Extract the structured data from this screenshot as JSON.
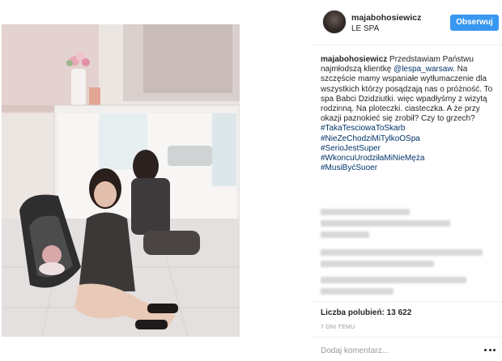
{
  "post": {
    "username": "majabohosiewicz",
    "location": "LE SPA",
    "follow_label": "Obserwuj",
    "caption": {
      "username": "majabohosiewicz",
      "text_before_mention": "Przedstawiam Państwu najmłodszą klientkę",
      "mention": "@lespa_warsaw",
      "text_after_mention": ". Na szczęście mamy wspaniałe wytłumaczenie dla wszystkich którzy posądzają nas o próżność. To spa Babci Dzidziutki. więc wpadłyśmy z wizytą rodzinną. Na ploteczki. ciasteczka. A że przy okazji paznokieć się zrobił? Czy to grzech?",
      "hashtags": [
        "#TakaTesciowaToSkarb",
        "#NieZeChodziMiTylkoOSpa",
        "#SerioJestSuper",
        "#WkoncuUrodziłaMiNieMęża",
        "#MusiByćSuoer"
      ]
    },
    "likes_label": "Liczba polubień: 13 622",
    "timestamp": "7 DNI TEMU",
    "comment_placeholder": "Dodaj komentarz...",
    "more_icon": "more-options-icon"
  },
  "colors": {
    "follow_button": "#3897f0",
    "link": "#003569",
    "muted": "#999999"
  }
}
